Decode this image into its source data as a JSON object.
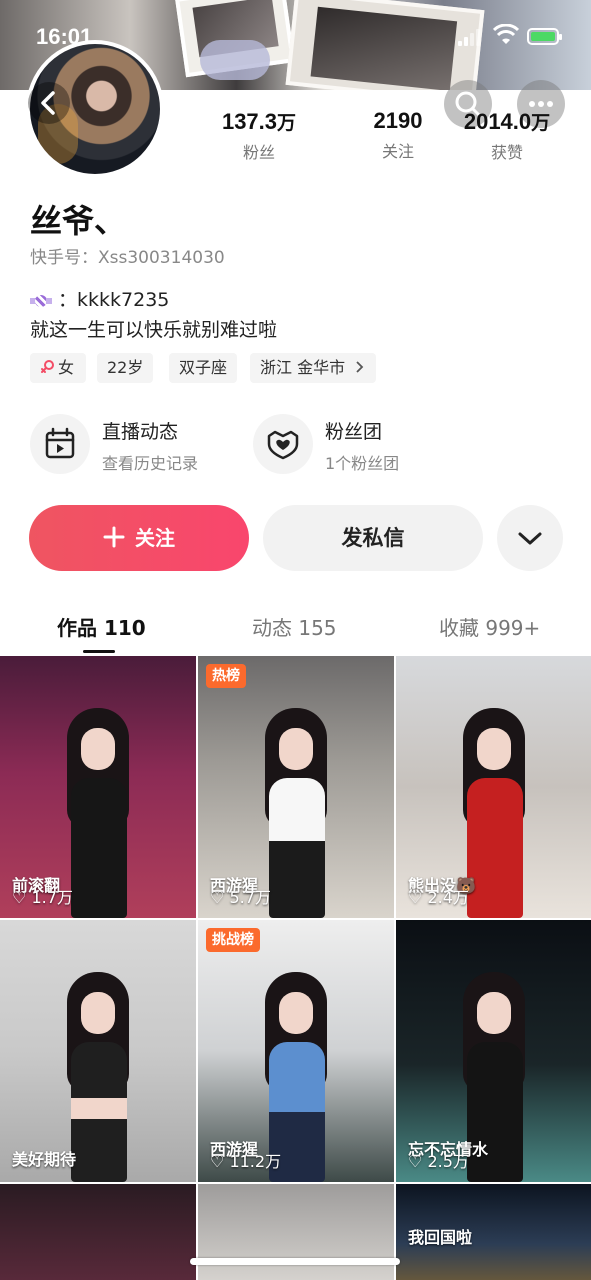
{
  "status_bar": {
    "time": "16:01"
  },
  "profile": {
    "name": "丝爷、",
    "id_label": "快手号：",
    "id_value": "Xss300314030",
    "bio_line1_prefix": "：",
    "bio_line1": "kkkk7235",
    "bio_line2": "就这一生可以快乐就别难过啦",
    "accent_color": "#f34d66"
  },
  "stats": [
    {
      "value": "137.3",
      "unit": "万",
      "label": "粉丝"
    },
    {
      "value": "2190",
      "unit": "",
      "label": "关注"
    },
    {
      "value": "2014.0",
      "unit": "万",
      "label": "获赞"
    }
  ],
  "tags": [
    {
      "icon": "female-icon",
      "label": "女"
    },
    {
      "label": "22岁"
    },
    {
      "label": "双子座"
    },
    {
      "label": "浙江 金华市",
      "icon": "chevron-right-icon"
    }
  ],
  "features": [
    {
      "icon": "calendar-play-icon",
      "title": "直播动态",
      "subtitle": "查看历史记录"
    },
    {
      "icon": "heart-badge-icon",
      "title": "粉丝团",
      "subtitle": "1个粉丝团"
    }
  ],
  "actions": {
    "follow": "关注",
    "message": "发私信"
  },
  "tabs": [
    {
      "label": "作品 110",
      "active": true
    },
    {
      "label": "动态 155",
      "active": false
    },
    {
      "label": "收藏 999+",
      "active": false
    }
  ],
  "grid": [
    {
      "badge": "",
      "caption": "前滚翻",
      "likes": "1.7万"
    },
    {
      "badge": "热榜",
      "caption": "西游猩",
      "likes": "5.7万"
    },
    {
      "badge": "",
      "caption": "熊出没🐻",
      "likes": "2.4万"
    },
    {
      "badge": "",
      "caption": "美好期待",
      "likes": ""
    },
    {
      "badge": "挑战榜",
      "caption": "西游猩",
      "likes": "11.2万"
    },
    {
      "badge": "",
      "caption": "忘不忘情水",
      "likes": "2.5万"
    },
    {
      "badge": "",
      "caption": "",
      "likes": ""
    },
    {
      "badge": "",
      "caption": "",
      "likes": ""
    },
    {
      "badge": "",
      "caption": "我回国啦",
      "likes": ""
    }
  ]
}
